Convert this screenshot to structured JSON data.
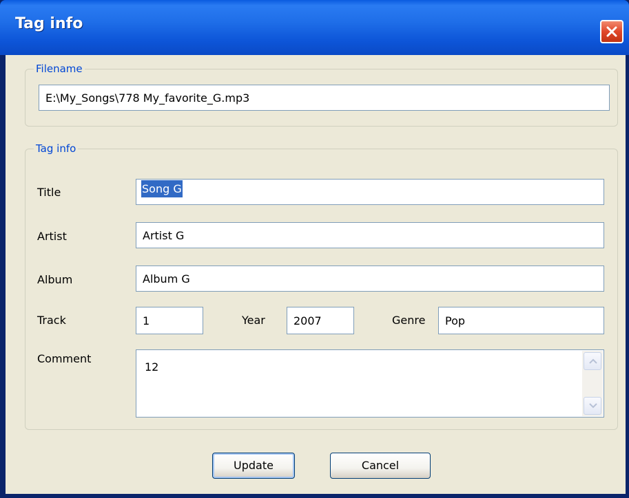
{
  "window": {
    "title": "Tag info"
  },
  "filename_group": {
    "legend": "Filename",
    "value": "E:\\My_Songs\\778 My_favorite_G.mp3"
  },
  "tag_group": {
    "legend": "Tag info",
    "title_label": "Title",
    "title_value": "Song G",
    "artist_label": "Artist",
    "artist_value": "Artist G",
    "album_label": "Album",
    "album_value": "Album G",
    "track_label": "Track",
    "track_value": "1",
    "year_label": "Year",
    "year_value": "2007",
    "genre_label": "Genre",
    "genre_value": "Pop",
    "comment_label": "Comment",
    "comment_value": "12"
  },
  "buttons": {
    "update": "Update",
    "cancel": "Cancel"
  },
  "icons": {
    "close": "close-icon",
    "scroll_up": "chevron-up-icon",
    "scroll_down": "chevron-down-icon"
  },
  "colors": {
    "titlebar": "#0a5be0",
    "close_button": "#e0482a",
    "selection": "#316ac5",
    "legend_text": "#0046d5",
    "dialog_face": "#ece9d8"
  }
}
